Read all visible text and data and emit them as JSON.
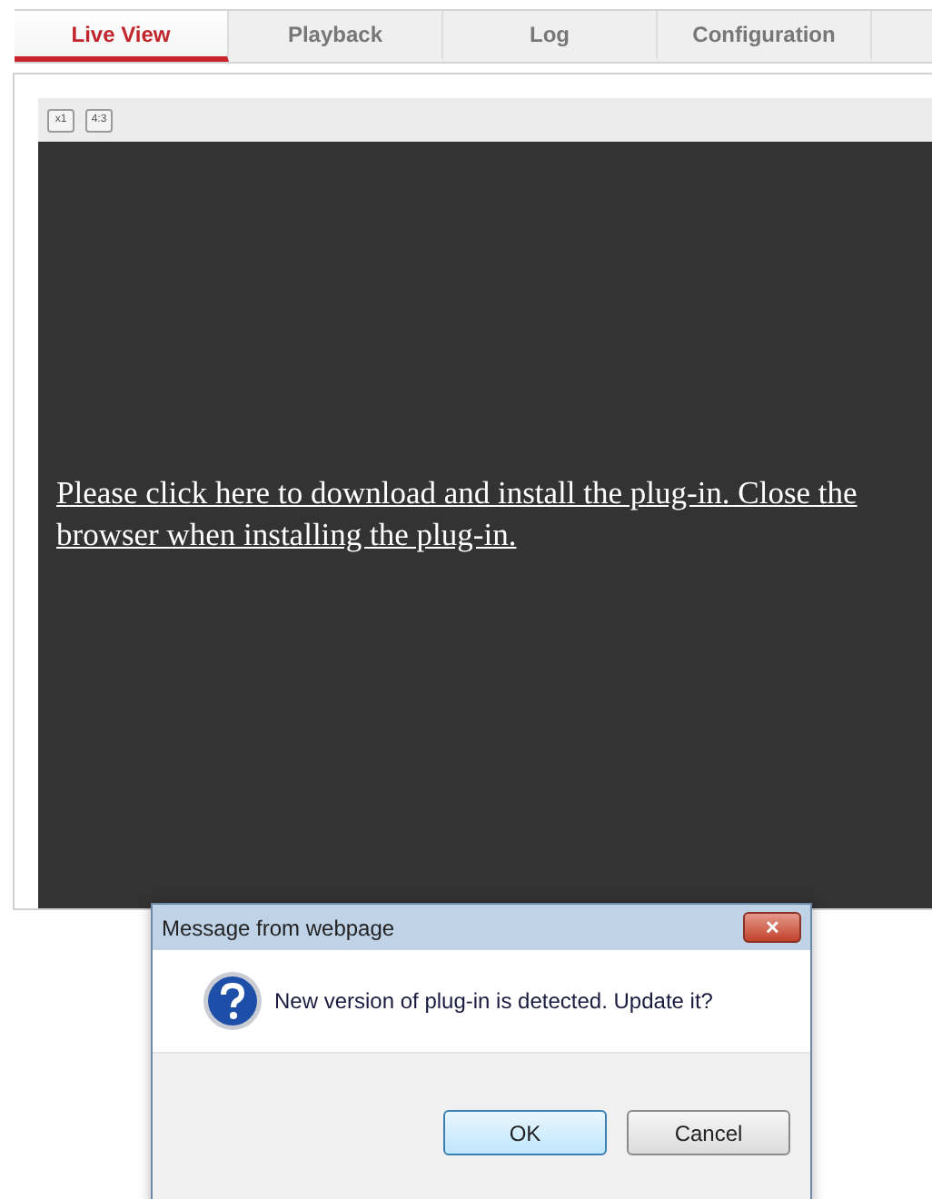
{
  "tabs": [
    {
      "label": "Live View",
      "selected": true
    },
    {
      "label": "Playback",
      "selected": false
    },
    {
      "label": "Log",
      "selected": false
    },
    {
      "label": "Configuration",
      "selected": false
    }
  ],
  "toolbar": {
    "buttons": [
      "x1",
      "4:3"
    ]
  },
  "video": {
    "message_link": "Please click here to download and install the plug-in. Close the browser when installing the plug-in."
  },
  "dialog": {
    "title": "Message from webpage",
    "close": "✕",
    "message": "New version of plug-in is detected. Update it?",
    "buttons": [
      {
        "label": "OK",
        "default": true
      },
      {
        "label": "Cancel",
        "default": false
      }
    ]
  }
}
